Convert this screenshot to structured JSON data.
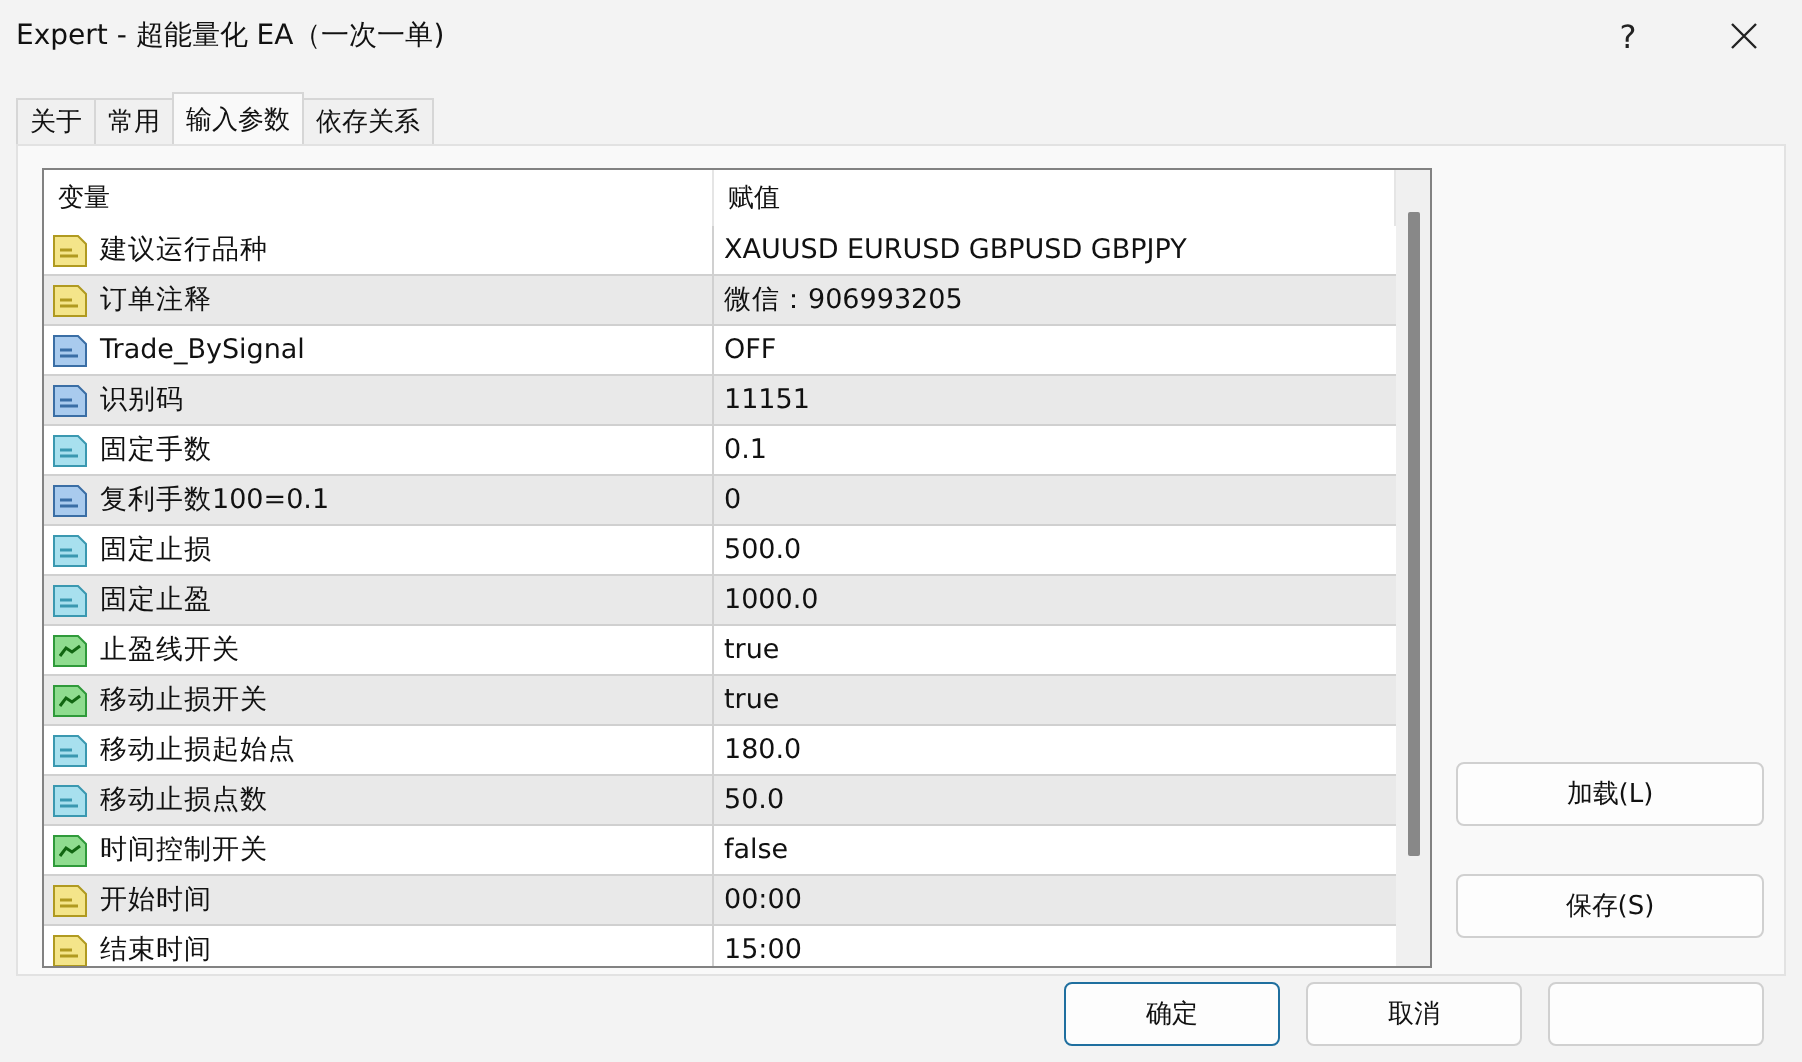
{
  "window": {
    "title": "Expert - 超能量化 EA（一次一单)",
    "help": "?"
  },
  "tabs": [
    {
      "label": "关于",
      "selected": false
    },
    {
      "label": "常用",
      "selected": false
    },
    {
      "label": "输入参数",
      "selected": true
    },
    {
      "label": "依存关系",
      "selected": false
    }
  ],
  "table": {
    "columns": [
      "变量",
      "赋值"
    ],
    "rows": [
      {
        "kind": "string",
        "name": "建议运行品种",
        "value": "XAUUSD EURUSD GBPUSD GBPJPY"
      },
      {
        "kind": "string",
        "name": "订单注释",
        "value": "微信：906993205"
      },
      {
        "kind": "integer",
        "name": "Trade_BySignal",
        "value": "OFF"
      },
      {
        "kind": "integer",
        "name": "识别码",
        "value": "11151"
      },
      {
        "kind": "double",
        "name": "固定手数",
        "value": "0.1"
      },
      {
        "kind": "integer",
        "name": "复利手数100=0.1",
        "value": "0"
      },
      {
        "kind": "double",
        "name": "固定止损",
        "value": "500.0"
      },
      {
        "kind": "double",
        "name": "固定止盈",
        "value": "1000.0"
      },
      {
        "kind": "bool",
        "name": "止盈线开关",
        "value": "true"
      },
      {
        "kind": "bool",
        "name": "移动止损开关",
        "value": "true"
      },
      {
        "kind": "double",
        "name": "移动止损起始点",
        "value": "180.0"
      },
      {
        "kind": "double",
        "name": "移动止损点数",
        "value": "50.0"
      },
      {
        "kind": "bool",
        "name": "时间控制开关",
        "value": "false"
      },
      {
        "kind": "string",
        "name": "开始时间",
        "value": "00:00"
      },
      {
        "kind": "string",
        "name": "结束时间",
        "value": "15:00"
      }
    ]
  },
  "side_buttons": [
    "加载(L)",
    "保存(S)"
  ],
  "buttons": [
    {
      "label": "确定",
      "default": true
    },
    {
      "label": "取消",
      "default": false
    },
    {
      "default": false
    }
  ]
}
